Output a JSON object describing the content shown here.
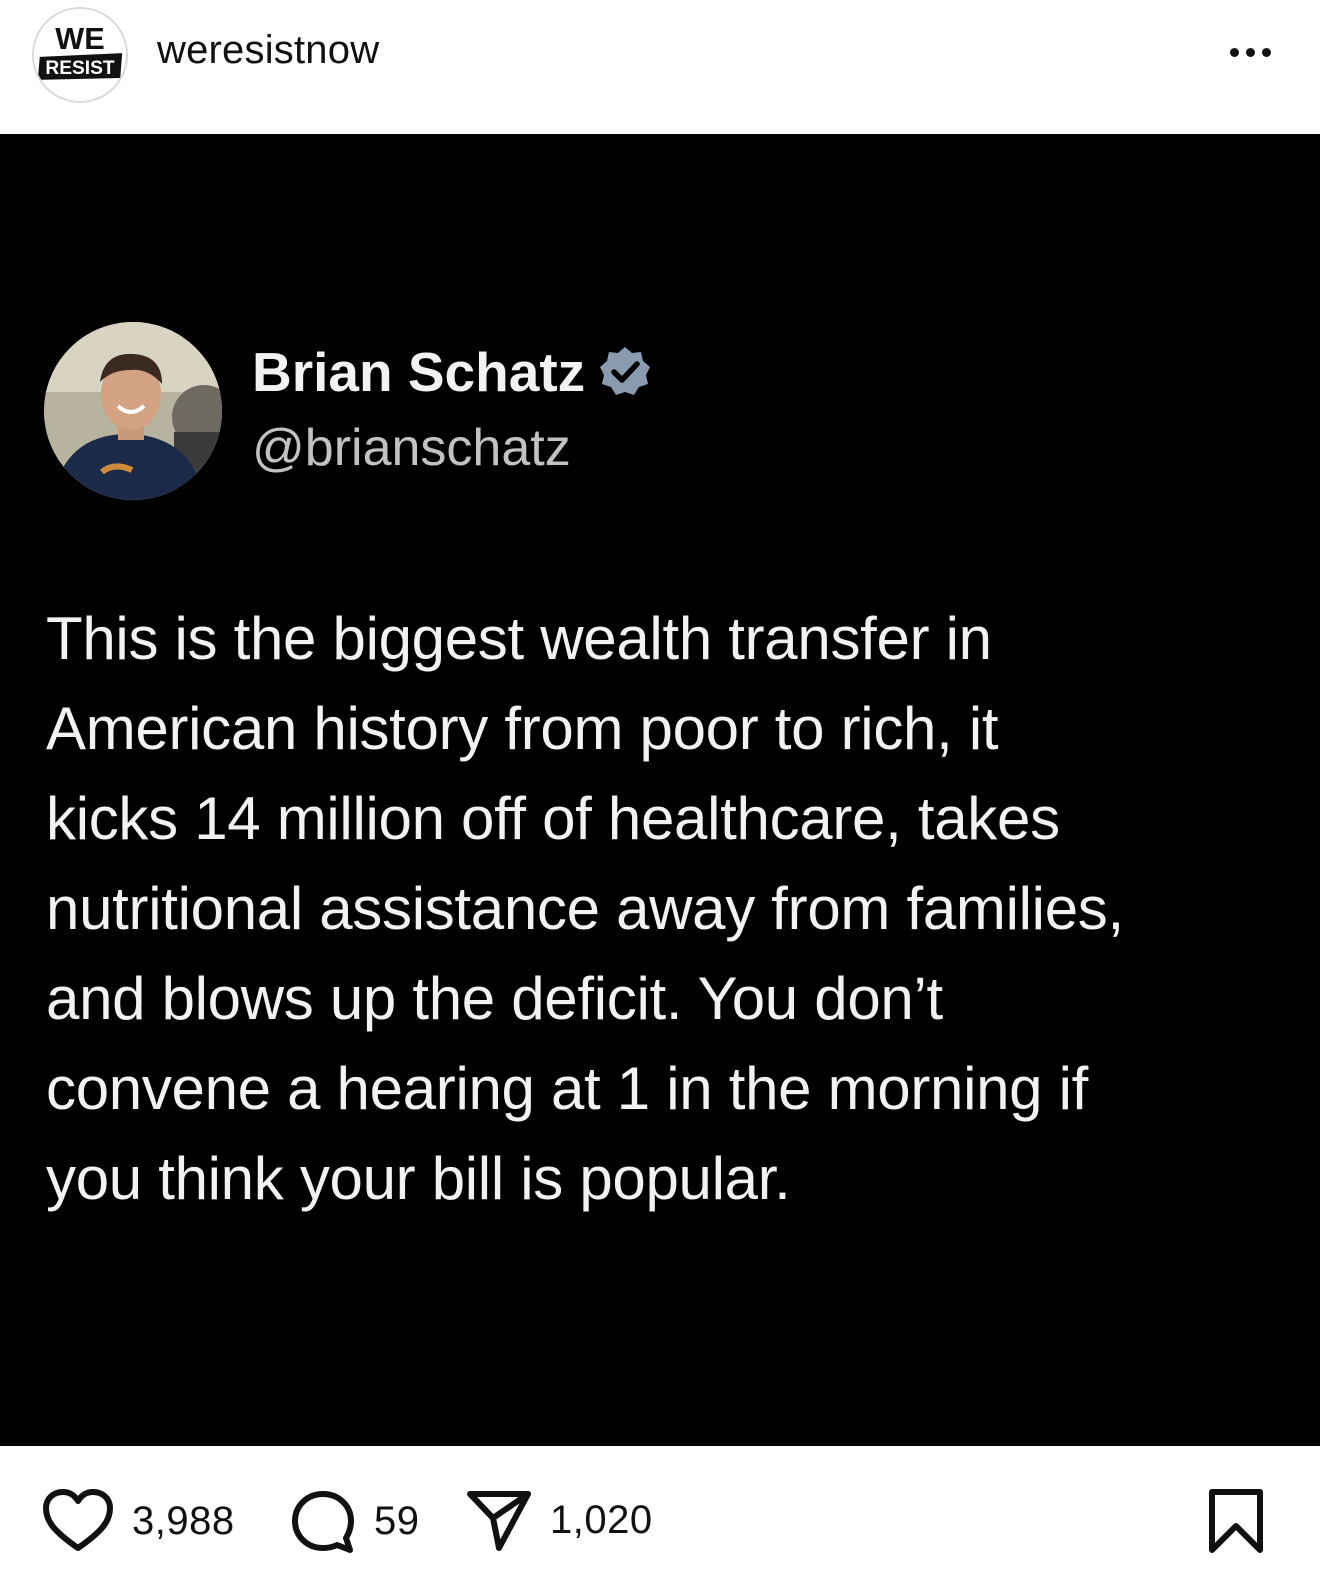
{
  "header": {
    "avatar_logo": {
      "line1": "WE",
      "line2": "RESIST"
    },
    "username": "weresistnow",
    "more_icon": "more-horizontal-icon"
  },
  "tweet": {
    "name": "Brian Schatz",
    "handle": "@brianschatz",
    "verified_badge_color": "#8a9bb0",
    "lines": [
      "This is the biggest wealth transfer in",
      "American history from poor to rich, it",
      "kicks 14 million off of healthcare, takes",
      "nutritional assistance away from families,",
      "and blows up the deficit. You don’t",
      "convene a hearing at 1 in the morning if",
      "you think your bill is popular."
    ],
    "background": "#000000",
    "text_color": "#f2f2f2"
  },
  "actions": {
    "likes": "3,988",
    "comments": "59",
    "shares": "1,020",
    "icons": [
      "heart-icon",
      "comment-icon",
      "send-icon",
      "bookmark-icon"
    ]
  }
}
